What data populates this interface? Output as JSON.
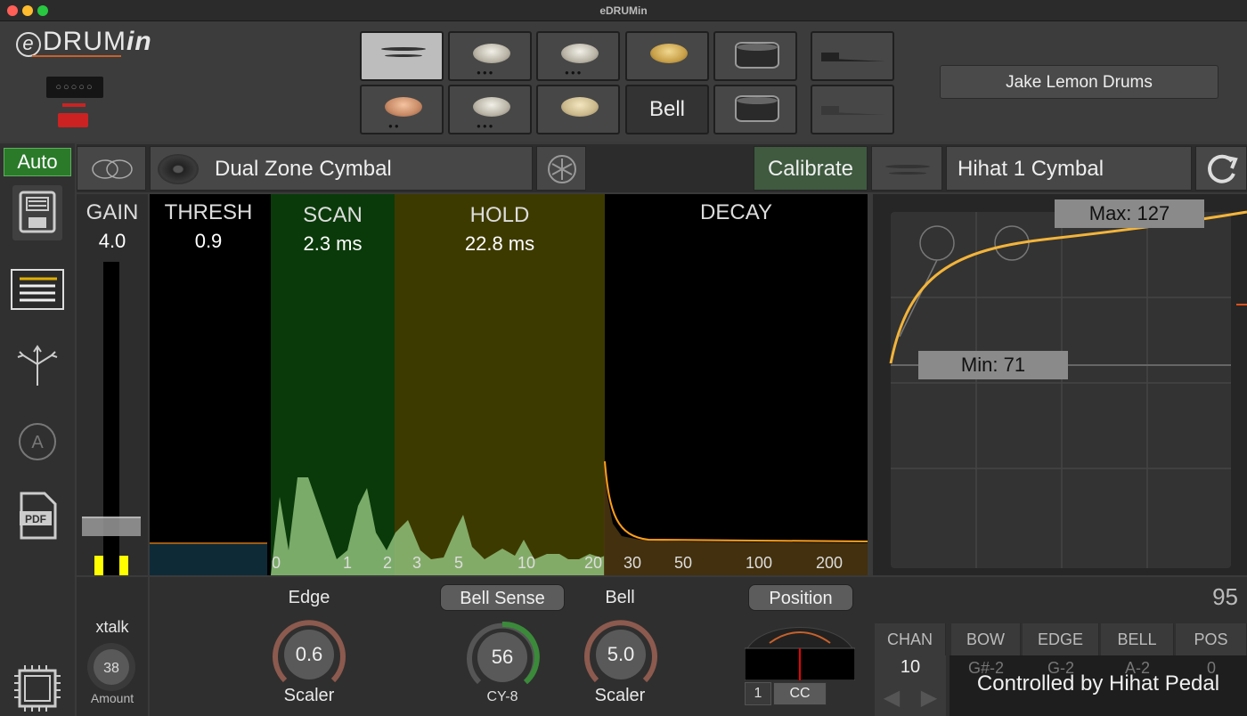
{
  "window": {
    "title": "eDRUMin"
  },
  "logo": {
    "e": "e",
    "drum": "DRUM",
    "in": "in"
  },
  "connector": {
    "label": "○○○○○"
  },
  "pads": {
    "bell_label": "Bell"
  },
  "kit": {
    "name": "Jake Lemon Drums"
  },
  "sidebar": {
    "auto": "Auto"
  },
  "pad_row": {
    "pad_type": "Dual Zone Cymbal",
    "calibrate": "Calibrate",
    "instrument": "Hihat 1 Cymbal"
  },
  "gain": {
    "label": "GAIN",
    "value": "4.0"
  },
  "zones": {
    "thresh": {
      "label": "THRESH",
      "value": "0.9"
    },
    "scan": {
      "label": "SCAN",
      "value": "2.3 ms"
    },
    "hold": {
      "label": "HOLD",
      "value": "22.8 ms"
    },
    "decay": {
      "label": "DECAY"
    }
  },
  "time_axis": [
    "0",
    "1",
    "2",
    "3",
    "5",
    "10",
    "20",
    "30",
    "50",
    "100",
    "200"
  ],
  "curve": {
    "max_label": "Max: 127",
    "min_label": "Min: 71"
  },
  "xtalk": {
    "label": "xtalk",
    "value": "38",
    "sub": "Amount"
  },
  "edge": {
    "label": "Edge",
    "value": "0.6",
    "sub": "Scaler"
  },
  "bell_sense": {
    "label": "Bell Sense",
    "value": "56",
    "sub": "CY-8"
  },
  "bell": {
    "label": "Bell",
    "value": "5.0",
    "sub": "Scaler"
  },
  "position": {
    "label": "Position",
    "channel_btn": "1",
    "cc_btn": "CC"
  },
  "velocity": {
    "value": "95"
  },
  "midi": {
    "headers": [
      "CHAN",
      "BOW",
      "EDGE",
      "BELL",
      "POS"
    ],
    "values": [
      "10",
      "G#-2",
      "G-2",
      "A-2",
      "0"
    ],
    "overlay": "Controlled by Hihat Pedal"
  }
}
